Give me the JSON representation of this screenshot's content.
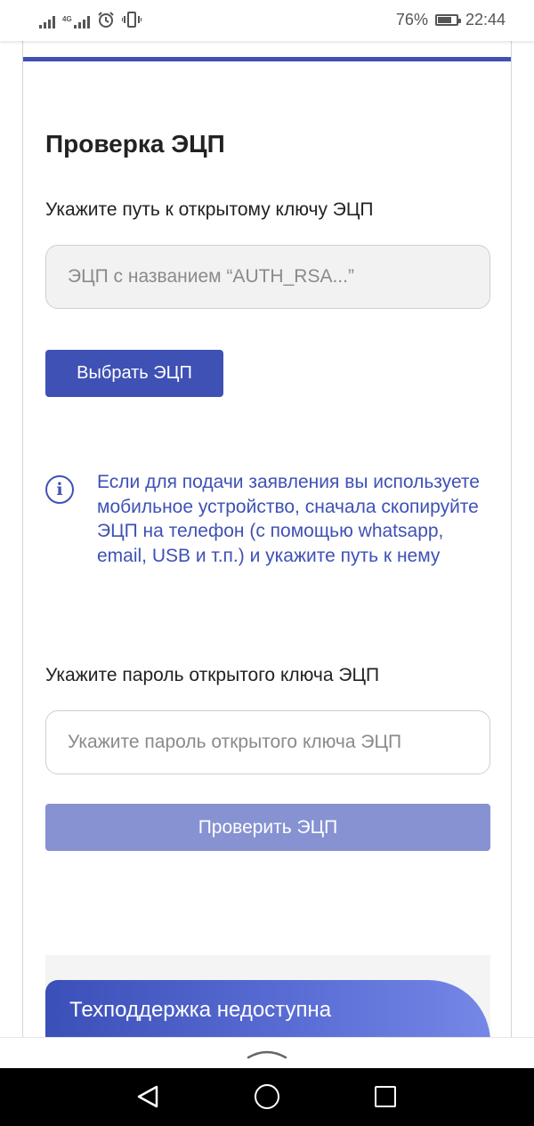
{
  "status_bar": {
    "network_tag": "4G",
    "battery_percent": "76%",
    "battery_level": 0.76,
    "time": "22:44",
    "icons": [
      "signal-icon",
      "signal-4g-icon",
      "alarm-icon",
      "vibrate-icon",
      "battery-icon"
    ]
  },
  "form": {
    "title": "Проверка ЭЦП",
    "key_path_label": "Укажите путь к открытому ключу ЭЦП",
    "key_path_placeholder": "ЭЦП с названием “AUTH_RSA...”",
    "choose_button": "Выбрать ЭЦП",
    "info_icon": "info-icon",
    "info_text": "Если для подачи заявления вы используете мобильное устройство, сначала скопируйте ЭЦП на телефон (с помощью whatsapp, email, USB и т.п.) и укажите путь к нему",
    "password_label": "Укажите пароль открытого ключа ЭЦП",
    "password_placeholder": "Укажите пароль открытого ключа ЭЦП",
    "verify_button": "Проверить ЭЦП"
  },
  "support": {
    "text": "Техподдержка недоступна"
  },
  "colors": {
    "accent": "#3f51b5",
    "button_disabled": "#8692d1",
    "info_text": "#3f51b5"
  }
}
